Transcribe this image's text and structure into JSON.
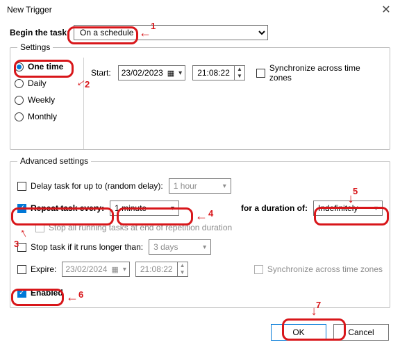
{
  "window": {
    "title": "New Trigger",
    "begin_label": "Begin the task:",
    "begin_value": "On a schedule"
  },
  "settings": {
    "legend": "Settings",
    "options": {
      "one_time": "One time",
      "daily": "Daily",
      "weekly": "Weekly",
      "monthly": "Monthly"
    },
    "selected": "one_time",
    "start_label": "Start:",
    "start_date": "23/02/2023",
    "start_time": "21:08:22",
    "sync_label": "Synchronize across time zones",
    "sync_checked": false
  },
  "advanced": {
    "legend": "Advanced settings",
    "delay": {
      "checked": false,
      "label": "Delay task for up to (random delay):",
      "value": "1 hour"
    },
    "repeat": {
      "checked": true,
      "label": "Repeat task every:",
      "interval": "1 minute",
      "duration_label": "for a duration of:",
      "duration_value": "Indefinitely"
    },
    "stop_repetition": {
      "checked": false,
      "label": "Stop all running tasks at end of repetition duration"
    },
    "stop_longer": {
      "checked": false,
      "label": "Stop task if it runs longer than:",
      "value": "3 days"
    },
    "expire": {
      "checked": false,
      "label": "Expire:",
      "date": "23/02/2024",
      "time": "21:08:22",
      "sync_label": "Synchronize across time zones"
    },
    "enabled": {
      "checked": true,
      "label": "Enabled"
    }
  },
  "buttons": {
    "ok": "OK",
    "cancel": "Cancel"
  },
  "annotations": {
    "n1": "1",
    "n2": "2",
    "n3": "3",
    "n4": "4",
    "n5": "5",
    "n6": "6",
    "n7": "7"
  }
}
